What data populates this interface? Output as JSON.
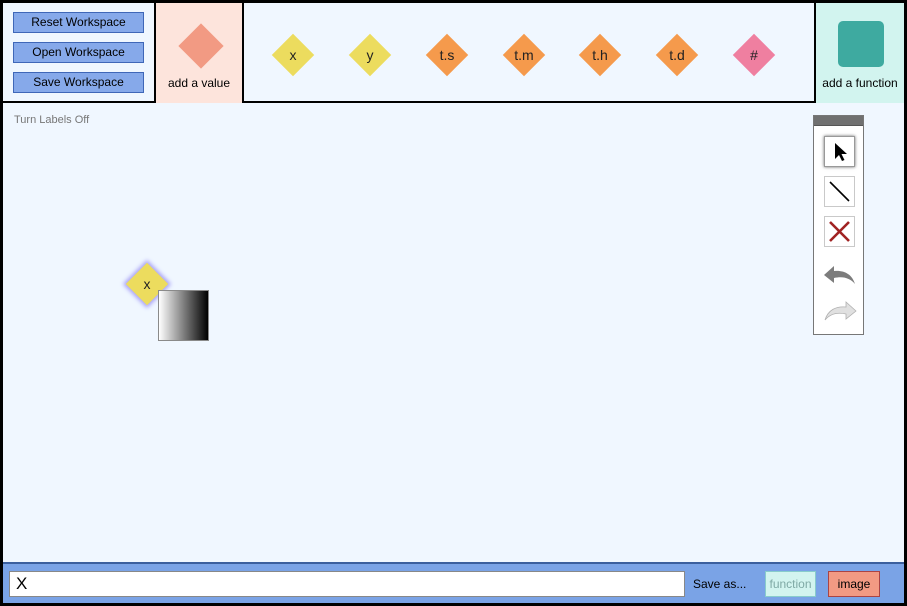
{
  "workspace_buttons": {
    "reset": "Reset Workspace",
    "open": "Open Workspace",
    "save": "Save Workspace"
  },
  "add_value": {
    "label": "add a value",
    "color": "#f29a83"
  },
  "add_function": {
    "label": "add a function",
    "color": "#3eaaa0"
  },
  "palette": [
    {
      "label": "x",
      "color": "#ecdc5e"
    },
    {
      "label": "y",
      "color": "#ecdc5e"
    },
    {
      "label": "t.s",
      "color": "#f59a4c"
    },
    {
      "label": "t.m",
      "color": "#f59a4c"
    },
    {
      "label": "t.h",
      "color": "#f59a4c"
    },
    {
      "label": "t.d",
      "color": "#f59a4c"
    },
    {
      "label": "#",
      "color": "#ef7fa0"
    }
  ],
  "canvas": {
    "labels_toggle": "Turn Labels Off",
    "node": {
      "label": "x"
    }
  },
  "tools": {
    "select": "pointer-icon",
    "line": "line-icon",
    "delete": "delete-x-icon",
    "undo": "undo-icon",
    "redo": "redo-icon"
  },
  "bottom": {
    "expression": "X",
    "save_as": "Save as...",
    "function_btn": "function",
    "image_btn": "image"
  }
}
